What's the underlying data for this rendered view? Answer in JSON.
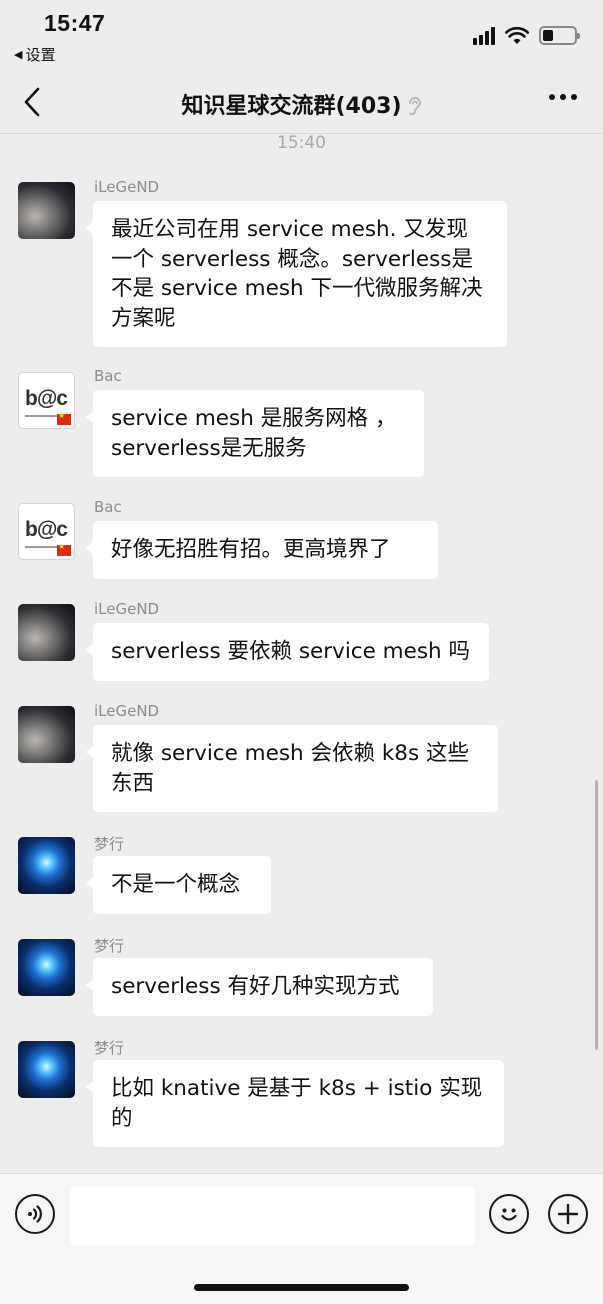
{
  "status_bar": {
    "time": "15:47",
    "back_app": "设置",
    "back_icon": "back-triangle-icon",
    "icons": [
      "signal-icon",
      "wifi-icon",
      "battery-icon"
    ]
  },
  "nav": {
    "back_icon": "chevron-left-icon",
    "title": "知识星球交流群(403)",
    "ear_icon": "earpiece-icon",
    "more_icon": "more-icon"
  },
  "chat": {
    "timestamp": "15:40",
    "messages": [
      {
        "sender": "iLeGeND",
        "avatar": "cat-avatar",
        "text": "最近公司在用 service mesh. 又发现一个 serverless 概念。serverless是不是 service mesh 下一代微服务解决方案呢"
      },
      {
        "sender": "Bac",
        "avatar": "bac-avatar",
        "avatar_text": "b@c",
        "text": "service mesh 是服务网格 ，serverless是无服务"
      },
      {
        "sender": "Bac",
        "avatar": "bac-avatar",
        "avatar_text": "b@c",
        "text": "好像无招胜有招。更高境界了"
      },
      {
        "sender": "iLeGeND",
        "avatar": "cat-avatar",
        "text": "serverless 要依赖 service mesh 吗"
      },
      {
        "sender": "iLeGeND",
        "avatar": "cat-avatar",
        "text": "就像 service mesh 会依赖 k8s 这些东西"
      },
      {
        "sender": "梦行",
        "avatar": "crystal-avatar",
        "text": "不是一个概念"
      },
      {
        "sender": "梦行",
        "avatar": "crystal-avatar",
        "text": "serverless 有好几种实现方式"
      },
      {
        "sender": "梦行",
        "avatar": "crystal-avatar",
        "text": "比如 knative 是基于 k8s + istio 实现的"
      }
    ]
  },
  "input_bar": {
    "voice_icon": "voice-icon",
    "message_value": "",
    "emoji_icon": "emoji-icon",
    "plus_icon": "plus-icon"
  },
  "colors": {
    "background": "#ededed",
    "bubble": "#ffffff",
    "sender": "#8c8c8c",
    "timestamp": "#a8a8a8"
  }
}
